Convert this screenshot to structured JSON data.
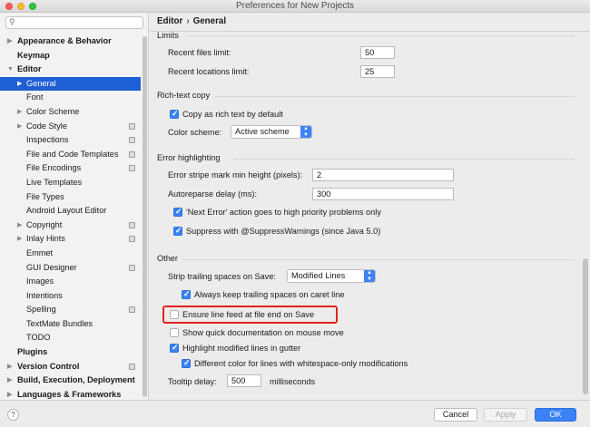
{
  "window": {
    "title": "Preferences for New Projects"
  },
  "search": {
    "placeholder": ""
  },
  "sidebar": {
    "items": [
      {
        "label": "Appearance & Behavior",
        "level": 0,
        "bold": true,
        "arrow": "right"
      },
      {
        "label": "Keymap",
        "level": 0,
        "bold": true
      },
      {
        "label": "Editor",
        "level": 0,
        "bold": true,
        "arrow": "down"
      },
      {
        "label": "General",
        "level": 1,
        "arrow": "right",
        "selected": true
      },
      {
        "label": "Font",
        "level": 1
      },
      {
        "label": "Color Scheme",
        "level": 1,
        "arrow": "right"
      },
      {
        "label": "Code Style",
        "level": 1,
        "arrow": "right",
        "icon": true
      },
      {
        "label": "Inspections",
        "level": 1,
        "icon": true
      },
      {
        "label": "File and Code Templates",
        "level": 1,
        "icon": true
      },
      {
        "label": "File Encodings",
        "level": 1,
        "icon": true
      },
      {
        "label": "Live Templates",
        "level": 1
      },
      {
        "label": "File Types",
        "level": 1
      },
      {
        "label": "Android Layout Editor",
        "level": 1
      },
      {
        "label": "Copyright",
        "level": 1,
        "arrow": "right",
        "icon": true
      },
      {
        "label": "Inlay Hints",
        "level": 1,
        "arrow": "right",
        "icon": true
      },
      {
        "label": "Emmet",
        "level": 1
      },
      {
        "label": "GUI Designer",
        "level": 1,
        "icon": true
      },
      {
        "label": "Images",
        "level": 1
      },
      {
        "label": "Intentions",
        "level": 1
      },
      {
        "label": "Spelling",
        "level": 1,
        "icon": true
      },
      {
        "label": "TextMate Bundles",
        "level": 1
      },
      {
        "label": "TODO",
        "level": 1
      },
      {
        "label": "Plugins",
        "level": 0,
        "bold": true
      },
      {
        "label": "Version Control",
        "level": 0,
        "bold": true,
        "arrow": "right",
        "icon": true
      },
      {
        "label": "Build, Execution, Deployment",
        "level": 0,
        "bold": true,
        "arrow": "right"
      },
      {
        "label": "Languages & Frameworks",
        "level": 0,
        "bold": true,
        "arrow": "right"
      }
    ]
  },
  "breadcrumb": {
    "parent": "Editor",
    "separator": "›",
    "current": "General"
  },
  "limits": {
    "section": "Limits",
    "recent_files_label": "Recent files limit:",
    "recent_files_value": "50",
    "recent_locations_label": "Recent locations limit:",
    "recent_locations_value": "25"
  },
  "richtext": {
    "section": "Rich-text copy",
    "copy_label": "Copy as rich text by default",
    "copy_checked": true,
    "scheme_label": "Color scheme:",
    "scheme_value": "Active scheme"
  },
  "errors": {
    "section": "Error highlighting",
    "stripe_label": "Error stripe mark min height (pixels):",
    "stripe_value": "2",
    "autoreparse_label": "Autoreparse delay (ms):",
    "autoreparse_value": "300",
    "next_error_label": "'Next Error' action goes to high priority problems only",
    "next_error_checked": true,
    "suppress_label": "Suppress with @SuppressWarnings (since Java 5.0)",
    "suppress_checked": true
  },
  "other": {
    "section": "Other",
    "strip_label": "Strip trailing spaces on Save:",
    "strip_value": "Modified Lines",
    "keep_caret_label": "Always keep trailing spaces on caret line",
    "keep_caret_checked": true,
    "line_feed_label": "Ensure line feed at file end on Save",
    "line_feed_checked": false,
    "quick_doc_label": "Show quick documentation on mouse move",
    "quick_doc_checked": false,
    "highlight_modified_label": "Highlight modified lines in gutter",
    "highlight_modified_checked": true,
    "diff_color_label": "Different color for lines with whitespace-only modifications",
    "diff_color_checked": true,
    "tooltip_label": "Tooltip delay:",
    "tooltip_value": "500",
    "tooltip_unit": "milliseconds"
  },
  "buttons": {
    "help": "?",
    "cancel": "Cancel",
    "apply": "Apply",
    "ok": "OK"
  },
  "colors": {
    "accent": "#3b82f6",
    "selection": "#1e5fd5",
    "highlight_box": "#e0231b"
  }
}
